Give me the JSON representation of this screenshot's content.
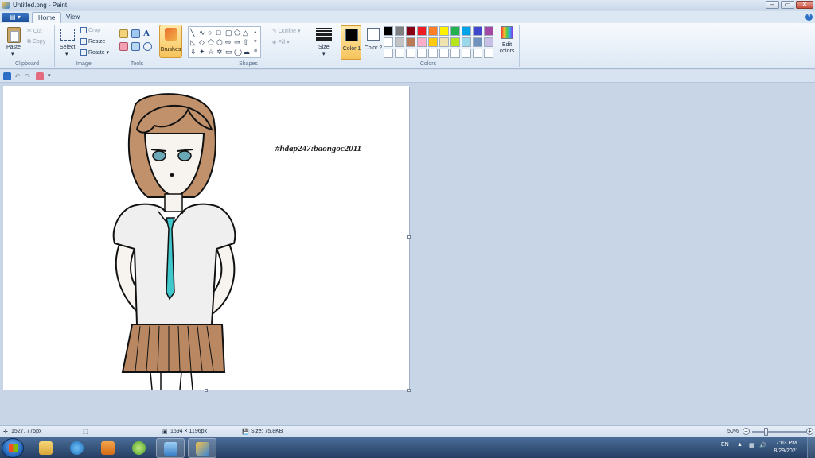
{
  "window": {
    "title": "Untitled.png - Paint"
  },
  "tabs": {
    "home": "Home",
    "view": "View"
  },
  "ribbon": {
    "clipboard": {
      "paste": "Paste",
      "cut": "Cut",
      "copy": "Copy",
      "group": "Clipboard"
    },
    "image": {
      "select": "Select",
      "crop": "Crop",
      "resize": "Resize",
      "rotate": "Rotate",
      "group": "Image"
    },
    "tools": {
      "group": "Tools",
      "brushes": "Brushes"
    },
    "shapes": {
      "outline": "Outline",
      "fill": "Fill",
      "group": "Shapes"
    },
    "size": {
      "label": "Size"
    },
    "colors": {
      "color1": "Color 1",
      "color2": "Color 2",
      "edit": "Edit colors",
      "group": "Colors"
    }
  },
  "palette": {
    "row1": [
      "#000000",
      "#7f7f7f",
      "#880015",
      "#ed1c24",
      "#ff7f27",
      "#fff200",
      "#22b14c",
      "#00a2e8",
      "#3f48cc",
      "#a349a4"
    ],
    "row2": [
      "#ffffff",
      "#c3c3c3",
      "#b97a57",
      "#ffaec9",
      "#ffc90e",
      "#efe4b0",
      "#b5e61d",
      "#99d9ea",
      "#7092be",
      "#c8bfe7"
    ],
    "row3": [
      "#ffffff",
      "#ffffff",
      "#ffffff",
      "#ffffff",
      "#ffffff",
      "#ffffff",
      "#ffffff",
      "#ffffff",
      "#ffffff",
      "#ffffff"
    ]
  },
  "active_colors": {
    "color1": "#000000",
    "color2": "#ffffff"
  },
  "canvas": {
    "text": "#hdap247:baongoc2011"
  },
  "status": {
    "cursor_position": "1527, 775px",
    "image_size": "1594 × 1196px",
    "file_size": "Size: 75.8KB",
    "zoom": "50%"
  },
  "taskbar": {
    "language": "EN",
    "time": "7:03 PM",
    "date": "8/29/2021"
  }
}
